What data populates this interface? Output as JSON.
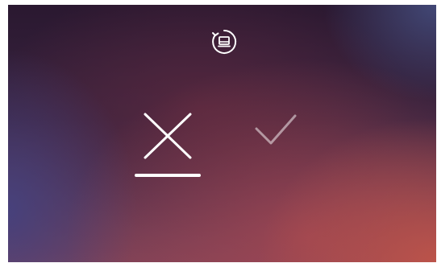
{
  "screen": {
    "controls": {
      "rotate": {
        "icon": "rotate-screen-icon",
        "color": "#ffffff"
      },
      "reject": {
        "icon": "close-icon",
        "state": "selected",
        "color": "#ffffff"
      },
      "accept": {
        "icon": "checkmark-icon",
        "state": "dimmed",
        "color": "#ffffff"
      }
    }
  }
}
